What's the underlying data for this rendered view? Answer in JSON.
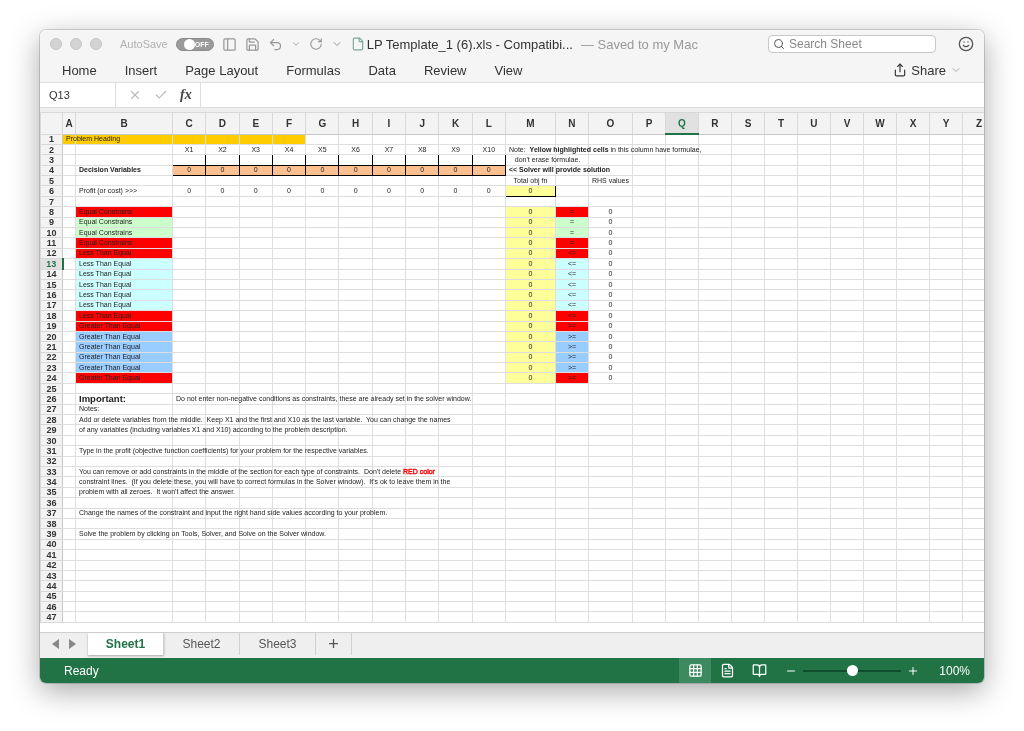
{
  "window": {
    "autosave_label": "AutoSave",
    "autosave": {
      "on": false,
      "label": "OFF"
    },
    "title": "LP Template_1 (6).xls  -  Compatibi...",
    "save_status": "— Saved to my Mac",
    "search": {
      "placeholder": "Search Sheet"
    }
  },
  "ribbon_tabs": [
    "Home",
    "Insert",
    "Page Layout",
    "Formulas",
    "Data",
    "Review",
    "View"
  ],
  "share": "Share",
  "formula_bar": {
    "name_box": "Q13",
    "fx": "fx"
  },
  "sheet": {
    "columns": [
      {
        "label": "A",
        "selected": false
      },
      {
        "label": "B",
        "selected": false
      },
      {
        "label": "C",
        "selected": false
      },
      {
        "label": "D",
        "selected": false
      },
      {
        "label": "E",
        "selected": false
      },
      {
        "label": "F",
        "selected": false
      },
      {
        "label": "G",
        "selected": false
      },
      {
        "label": "H",
        "selected": false
      },
      {
        "label": "I",
        "selected": false
      },
      {
        "label": "J",
        "selected": false
      },
      {
        "label": "K",
        "selected": false
      },
      {
        "label": "L",
        "selected": false
      },
      {
        "label": "M",
        "selected": false
      },
      {
        "label": "N",
        "selected": false
      },
      {
        "label": "O",
        "selected": false
      },
      {
        "label": "P",
        "selected": false
      },
      {
        "label": "Q",
        "selected": true
      },
      {
        "label": "R",
        "selected": false
      },
      {
        "label": "S",
        "selected": false
      },
      {
        "label": "T",
        "selected": false
      },
      {
        "label": "U",
        "selected": false
      },
      {
        "label": "V",
        "selected": false
      },
      {
        "label": "W",
        "selected": false
      },
      {
        "label": "X",
        "selected": false
      },
      {
        "label": "Y",
        "selected": false
      },
      {
        "label": "Z",
        "selected": false
      }
    ],
    "rows": [
      {
        "number": "1",
        "selected": false,
        "cells": {
          "A": {
            "kind": "label",
            "text": "Problem Heading",
            "color": "#ffcc00"
          },
          "B": {
            "color": "#ffcc00"
          },
          "C": {
            "color": "#ffcc00"
          },
          "D": {
            "color": "#ffcc00"
          },
          "E": {
            "color": "#ffcc00"
          },
          "F": {
            "color": "#ffcc00"
          }
        }
      },
      {
        "number": "2",
        "selected": false,
        "cells": {
          "C": {
            "kind": "value",
            "text": "X1"
          },
          "D": {
            "kind": "value",
            "text": "X2"
          },
          "E": {
            "kind": "value",
            "text": "X3"
          },
          "F": {
            "kind": "value",
            "text": "X4"
          },
          "G": {
            "kind": "value",
            "text": "X5"
          },
          "H": {
            "kind": "value",
            "text": "X6"
          },
          "I": {
            "kind": "value",
            "text": "X7"
          },
          "J": {
            "kind": "value",
            "text": "X8"
          },
          "K": {
            "kind": "value",
            "text": "X9"
          },
          "L": {
            "kind": "value",
            "text": "X10"
          },
          "M": {
            "kind": "label",
            "text": "Note:  **Yellow highlighted cells** in this column have formulae,"
          }
        }
      },
      {
        "number": "3",
        "selected": false,
        "cells": {
          "C": {
            "boxed": true
          },
          "D": {
            "boxed": true
          },
          "E": {
            "boxed": true
          },
          "F": {
            "boxed": true
          },
          "G": {
            "boxed": true
          },
          "H": {
            "boxed": true
          },
          "I": {
            "boxed": true
          },
          "J": {
            "boxed": true
          },
          "K": {
            "boxed": true
          },
          "L": {
            "boxed": true
          },
          "M": {
            "kind": "label",
            "text": "   don't erase formulae."
          }
        }
      },
      {
        "number": "4",
        "selected": false,
        "cells": {
          "B": {
            "kind": "label",
            "text": "Decision Variables",
            "bold": true
          },
          "C": {
            "kind": "value",
            "text": "0",
            "color": "#fac090",
            "boxed": true
          },
          "D": {
            "kind": "value",
            "text": "0",
            "color": "#fac090",
            "boxed": true
          },
          "E": {
            "kind": "value",
            "text": "0",
            "color": "#fac090",
            "boxed": true
          },
          "F": {
            "kind": "value",
            "text": "0",
            "color": "#fac090",
            "boxed": true
          },
          "G": {
            "kind": "value",
            "text": "0",
            "color": "#fac090",
            "boxed": true
          },
          "H": {
            "kind": "value",
            "text": "0",
            "color": "#fac090",
            "boxed": true
          },
          "I": {
            "kind": "value",
            "text": "0",
            "color": "#fac090",
            "boxed": true
          },
          "J": {
            "kind": "value",
            "text": "0",
            "color": "#fac090",
            "boxed": true
          },
          "K": {
            "kind": "value",
            "text": "0",
            "color": "#fac090",
            "boxed": true
          },
          "L": {
            "kind": "value",
            "text": "0",
            "color": "#fac090",
            "boxed": true
          },
          "M": {
            "kind": "label",
            "text": "<< Solver will provide solution",
            "bold": true
          }
        }
      },
      {
        "number": "5",
        "selected": false,
        "cells": {
          "M": {
            "kind": "value",
            "text": "Total obj fn"
          },
          "O": {
            "kind": "value",
            "text": "RHS values"
          }
        }
      },
      {
        "number": "6",
        "selected": false,
        "cells": {
          "B": {
            "kind": "label",
            "text": "Profit (or cost) >>>"
          },
          "C": {
            "kind": "value",
            "text": "0"
          },
          "D": {
            "kind": "value",
            "text": "0"
          },
          "E": {
            "kind": "value",
            "text": "0"
          },
          "F": {
            "kind": "value",
            "text": "0"
          },
          "G": {
            "kind": "value",
            "text": "0"
          },
          "H": {
            "kind": "value",
            "text": "0"
          },
          "I": {
            "kind": "value",
            "text": "0"
          },
          "J": {
            "kind": "value",
            "text": "0"
          },
          "K": {
            "kind": "value",
            "text": "0"
          },
          "L": {
            "kind": "value",
            "text": "0"
          },
          "M": {
            "kind": "value",
            "text": "0",
            "color": "#ffff99",
            "boxed": true
          }
        }
      },
      {
        "number": "7",
        "selected": false
      },
      {
        "number": "8",
        "selected": false,
        "cells": {
          "B": {
            "kind": "label",
            "text": "Equal Constrains",
            "color": "#ff0000"
          },
          "M": {
            "kind": "value",
            "text": "0",
            "color": "#ffff99"
          },
          "N": {
            "kind": "value",
            "text": "=",
            "color": "#ff0000"
          },
          "O": {
            "kind": "value",
            "text": "0"
          }
        }
      },
      {
        "number": "9",
        "selected": false,
        "cells": {
          "B": {
            "kind": "label",
            "text": "Equal Constrains",
            "color": "#ccffcc"
          },
          "M": {
            "kind": "value",
            "text": "0",
            "color": "#ffff99"
          },
          "N": {
            "kind": "value",
            "text": "=",
            "color": "#ccffcc"
          },
          "O": {
            "kind": "value",
            "text": "0"
          }
        }
      },
      {
        "number": "10",
        "selected": false,
        "cells": {
          "B": {
            "kind": "label",
            "text": "Equal Constrains",
            "color": "#ccffcc"
          },
          "M": {
            "kind": "value",
            "text": "0",
            "color": "#ffff99"
          },
          "N": {
            "kind": "value",
            "text": "=",
            "color": "#ccffcc"
          },
          "O": {
            "kind": "value",
            "text": "0"
          }
        }
      },
      {
        "number": "11",
        "selected": false,
        "cells": {
          "B": {
            "kind": "label",
            "text": "Equal Constrains",
            "color": "#ff0000"
          },
          "M": {
            "kind": "value",
            "text": "0",
            "color": "#ffff99"
          },
          "N": {
            "kind": "value",
            "text": "=",
            "color": "#ff0000"
          },
          "O": {
            "kind": "value",
            "text": "0"
          }
        }
      },
      {
        "number": "12",
        "selected": false,
        "cells": {
          "B": {
            "kind": "label",
            "text": "Less Than Equal",
            "color": "#ff0000"
          },
          "M": {
            "kind": "value",
            "text": "0",
            "color": "#ffff99"
          },
          "N": {
            "kind": "value",
            "text": "<=",
            "color": "#ff0000"
          },
          "O": {
            "kind": "value",
            "text": "0"
          }
        }
      },
      {
        "number": "13",
        "selected": true,
        "cells": {
          "B": {
            "kind": "label",
            "text": "Less Than Equal",
            "color": "#ccffff"
          },
          "M": {
            "kind": "value",
            "text": "0",
            "color": "#ffff99"
          },
          "N": {
            "kind": "value",
            "text": "<=",
            "color": "#ccffff"
          },
          "O": {
            "kind": "value",
            "text": "0"
          }
        }
      },
      {
        "number": "14",
        "selected": false,
        "cells": {
          "B": {
            "kind": "label",
            "text": "Less Than Equal",
            "color": "#ccffff"
          },
          "M": {
            "kind": "value",
            "text": "0",
            "color": "#ffff99"
          },
          "N": {
            "kind": "value",
            "text": "<=",
            "color": "#ccffff"
          },
          "O": {
            "kind": "value",
            "text": "0"
          }
        }
      },
      {
        "number": "15",
        "selected": false,
        "cells": {
          "B": {
            "kind": "label",
            "text": "Less Than Equal",
            "color": "#ccffff"
          },
          "M": {
            "kind": "value",
            "text": "0",
            "color": "#ffff99"
          },
          "N": {
            "kind": "value",
            "text": "<=",
            "color": "#ccffff"
          },
          "O": {
            "kind": "value",
            "text": "0"
          }
        }
      },
      {
        "number": "16",
        "selected": false,
        "cells": {
          "B": {
            "kind": "label",
            "text": "Less Than Equal",
            "color": "#ccffff"
          },
          "M": {
            "kind": "value",
            "text": "0",
            "color": "#ffff99"
          },
          "N": {
            "kind": "value",
            "text": "<=",
            "color": "#ccffff"
          },
          "O": {
            "kind": "value",
            "text": "0"
          }
        }
      },
      {
        "number": "17",
        "selected": false,
        "cells": {
          "B": {
            "kind": "label",
            "text": "Less Than Equal",
            "color": "#ccffff"
          },
          "M": {
            "kind": "value",
            "text": "0",
            "color": "#ffff99"
          },
          "N": {
            "kind": "value",
            "text": "<=",
            "color": "#ccffff"
          },
          "O": {
            "kind": "value",
            "text": "0"
          }
        }
      },
      {
        "number": "18",
        "selected": false,
        "cells": {
          "B": {
            "kind": "label",
            "text": "Less Than Equal",
            "color": "#ff0000"
          },
          "M": {
            "kind": "value",
            "text": "0",
            "color": "#ffff99"
          },
          "N": {
            "kind": "value",
            "text": "<=",
            "color": "#ff0000"
          },
          "O": {
            "kind": "value",
            "text": "0"
          }
        }
      },
      {
        "number": "19",
        "selected": false,
        "cells": {
          "B": {
            "kind": "label",
            "text": "Greater Than Equal",
            "color": "#ff0000"
          },
          "M": {
            "kind": "value",
            "text": "0",
            "color": "#ffff99"
          },
          "N": {
            "kind": "value",
            "text": ">=",
            "color": "#ff0000"
          },
          "O": {
            "kind": "value",
            "text": "0"
          }
        }
      },
      {
        "number": "20",
        "selected": false,
        "cells": {
          "B": {
            "kind": "label",
            "text": "Greater Than Equal",
            "color": "#99ccff"
          },
          "M": {
            "kind": "value",
            "text": "0",
            "color": "#ffff99"
          },
          "N": {
            "kind": "value",
            "text": ">=",
            "color": "#99ccff"
          },
          "O": {
            "kind": "value",
            "text": "0"
          }
        }
      },
      {
        "number": "21",
        "selected": false,
        "cells": {
          "B": {
            "kind": "label",
            "text": "Greater Than Equal",
            "color": "#99ccff"
          },
          "M": {
            "kind": "value",
            "text": "0",
            "color": "#ffff99"
          },
          "N": {
            "kind": "value",
            "text": ">=",
            "color": "#99ccff"
          },
          "O": {
            "kind": "value",
            "text": "0"
          }
        }
      },
      {
        "number": "22",
        "selected": false,
        "cells": {
          "B": {
            "kind": "label",
            "text": "Greater Than Equal",
            "color": "#99ccff"
          },
          "M": {
            "kind": "value",
            "text": "0",
            "color": "#ffff99"
          },
          "N": {
            "kind": "value",
            "text": ">=",
            "color": "#99ccff"
          },
          "O": {
            "kind": "value",
            "text": "0"
          }
        }
      },
      {
        "number": "23",
        "selected": false,
        "cells": {
          "B": {
            "kind": "label",
            "text": "Greater Than Equal",
            "color": "#99ccff"
          },
          "M": {
            "kind": "value",
            "text": "0",
            "color": "#ffff99"
          },
          "N": {
            "kind": "value",
            "text": ">=",
            "color": "#99ccff"
          },
          "O": {
            "kind": "value",
            "text": "0"
          }
        }
      },
      {
        "number": "24",
        "selected": false,
        "cells": {
          "B": {
            "kind": "label",
            "text": "Greater Than Equal",
            "color": "#ff0000"
          },
          "M": {
            "kind": "value",
            "text": "0",
            "color": "#ffff99"
          },
          "N": {
            "kind": "value",
            "text": ">=",
            "color": "#ff0000"
          },
          "O": {
            "kind": "value",
            "text": "0"
          }
        }
      },
      {
        "number": "25",
        "selected": false
      },
      {
        "number": "26",
        "selected": false,
        "cells": {
          "B": {
            "kind": "heading",
            "text": "Important:"
          },
          "C": {
            "kind": "label",
            "text": "Do not enter non-negative conditions as constraints, these are already set in the solver window."
          }
        }
      },
      {
        "number": "27",
        "selected": false,
        "cells": {
          "B": {
            "kind": "label",
            "text": "Notes:"
          }
        }
      },
      {
        "number": "28",
        "selected": false,
        "cells": {
          "B": {
            "kind": "label",
            "text": "Add or delete variables from the middle.  Keep X1 and the first and X10 as the last variable.  You can change the names"
          }
        }
      },
      {
        "number": "29",
        "selected": false,
        "cells": {
          "B": {
            "kind": "label",
            "text": "of any variables (including variables X1 and X10) according to the problem description."
          }
        }
      },
      {
        "number": "30",
        "selected": false
      },
      {
        "number": "31",
        "selected": false,
        "cells": {
          "B": {
            "kind": "label",
            "text": "Type in the profit (objective function coefficients) for your problem for the respective variables."
          }
        }
      },
      {
        "number": "32",
        "selected": false
      },
      {
        "number": "33",
        "selected": false,
        "cells": {
          "B": {
            "kind": "label",
            "segments": [
              {
                "text": "You can remove or add constraints in the middle of the section for each type of constraints.  Don't delete "
              },
              {
                "text": "RED color",
                "color": "#ff0000"
              }
            ]
          }
        }
      },
      {
        "number": "34",
        "selected": false,
        "cells": {
          "B": {
            "kind": "label",
            "text": "constraint lines.  (If you delete these, you will have to correct formulas in the Solver window).  It's ok to leave them in the"
          }
        }
      },
      {
        "number": "35",
        "selected": false,
        "cells": {
          "B": {
            "kind": "label",
            "text": "problem with all zeroes.  It won't affect the answer."
          }
        }
      },
      {
        "number": "36",
        "selected": false
      },
      {
        "number": "37",
        "selected": false,
        "cells": {
          "B": {
            "kind": "label",
            "text": "Change the names of the constraint and input the right hand side values according to your problem."
          }
        }
      },
      {
        "number": "38",
        "selected": false
      },
      {
        "number": "39",
        "selected": false,
        "cells": {
          "B": {
            "kind": "label",
            "text": "Solve the problem by clicking on Tools, Solver, and Solve on the Solver window."
          }
        }
      },
      {
        "number": "40",
        "selected": false
      },
      {
        "number": "41",
        "selected": false
      },
      {
        "number": "42",
        "selected": false
      },
      {
        "number": "43",
        "selected": false
      },
      {
        "number": "44",
        "selected": false
      },
      {
        "number": "45",
        "selected": false
      },
      {
        "number": "46",
        "selected": false
      },
      {
        "number": "47",
        "selected": false
      }
    ]
  },
  "sheet_tabs": [
    {
      "label": "Sheet1",
      "selected": true
    },
    {
      "label": "Sheet2",
      "selected": false
    },
    {
      "label": "Sheet3",
      "selected": false
    }
  ],
  "add_sheet": "+",
  "status_bar": {
    "status": "Ready",
    "views": [
      {
        "kind": "normal",
        "selected": true
      },
      {
        "kind": "page_layout",
        "selected": false
      },
      {
        "kind": "page_break",
        "selected": false
      }
    ],
    "zoom": {
      "level": 0.5,
      "label": "100%"
    }
  }
}
